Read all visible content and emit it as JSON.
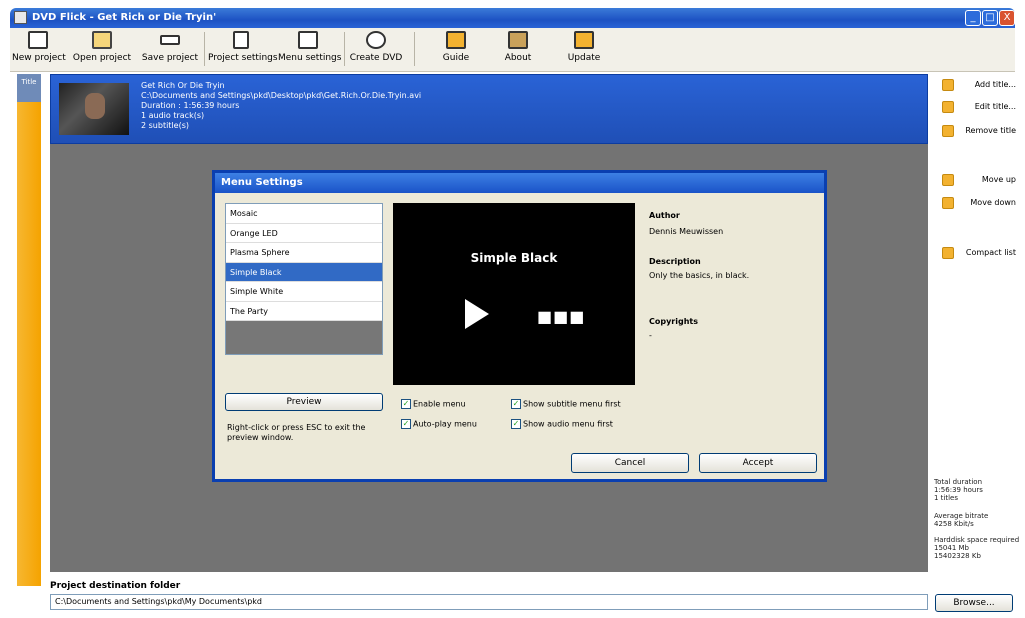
{
  "window": {
    "title": "DVD Flick - Get Rich or Die Tryin'",
    "controls": [
      "_",
      "□",
      "X"
    ]
  },
  "toolbar": {
    "buttons": [
      {
        "label": "New project",
        "icon": "new-project-icon"
      },
      {
        "label": "Open project",
        "icon": "folder-icon"
      },
      {
        "label": "Save project",
        "icon": "save-icon"
      },
      {
        "label": "Project settings",
        "icon": "project-settings-icon"
      },
      {
        "label": "Menu settings",
        "icon": "menu-settings-icon"
      },
      {
        "label": "Create DVD",
        "icon": "create-dvd-icon"
      },
      {
        "label": "Guide",
        "icon": "guide-icon"
      },
      {
        "label": "About",
        "icon": "about-icon"
      },
      {
        "label": "Update",
        "icon": "update-icon"
      }
    ]
  },
  "title_list": {
    "tag": "Title",
    "item": {
      "line1": "Get Rich Or Die Tryin",
      "line2": "C:\\Documents and Settings\\pkd\\Desktop\\pkd\\Get.Rich.Or.Die.Tryin.avi",
      "line3": "Duration : 1:56:39 hours",
      "line4": "1 audio track(s)",
      "line5": "2 subtitle(s)"
    }
  },
  "right_panel": {
    "actions": [
      {
        "label": "Add title...",
        "icon": "add-title-icon"
      },
      {
        "label": "Edit title...",
        "icon": "edit-title-icon"
      },
      {
        "label": "Remove title",
        "icon": "remove-title-icon"
      },
      {
        "label": "Move up",
        "icon": "move-up-icon"
      },
      {
        "label": "Move down",
        "icon": "move-down-icon"
      },
      {
        "label": "Compact list",
        "icon": "compact-list-icon"
      }
    ],
    "stats": {
      "total_duration_label": "Total duration",
      "total_duration": "1:56:39 hours",
      "titles": "1 titles",
      "bitrate_label": "Average bitrate",
      "bitrate": "4258 Kbit/s",
      "harddisk_label": "Harddisk space required",
      "harddisk_mb": "15041 Mb",
      "harddisk_kb": "15402328 Kb"
    }
  },
  "destination": {
    "label": "Project destination folder",
    "value": "C:\\Documents and Settings\\pkd\\My Documents\\pkd",
    "browse_label": "Browse..."
  },
  "dialog": {
    "title": "Menu Settings",
    "menus": [
      "Mosaic",
      "Orange LED",
      "Plasma Sphere",
      "Simple Black",
      "Simple White",
      "The Party"
    ],
    "selected_index": 3,
    "preview_label": "Preview",
    "hint": "Right-click or press ESC to exit the preview window.",
    "preview_title": "Simple Black",
    "preview_dots": "■■■",
    "author_label": "Author",
    "author": "Dennis Meuwissen",
    "description_label": "Description",
    "description": "Only the basics, in black.",
    "copyrights_label": "Copyrights",
    "copyrights": "-",
    "enable_menu": "Enable menu",
    "autoplay_menu": "Auto-play menu",
    "show_subtitle_first": "Show subtitle menu first",
    "show_audio_first": "Show audio menu first",
    "check_mark": "✓",
    "cancel_label": "Cancel",
    "accept_label": "Accept"
  }
}
